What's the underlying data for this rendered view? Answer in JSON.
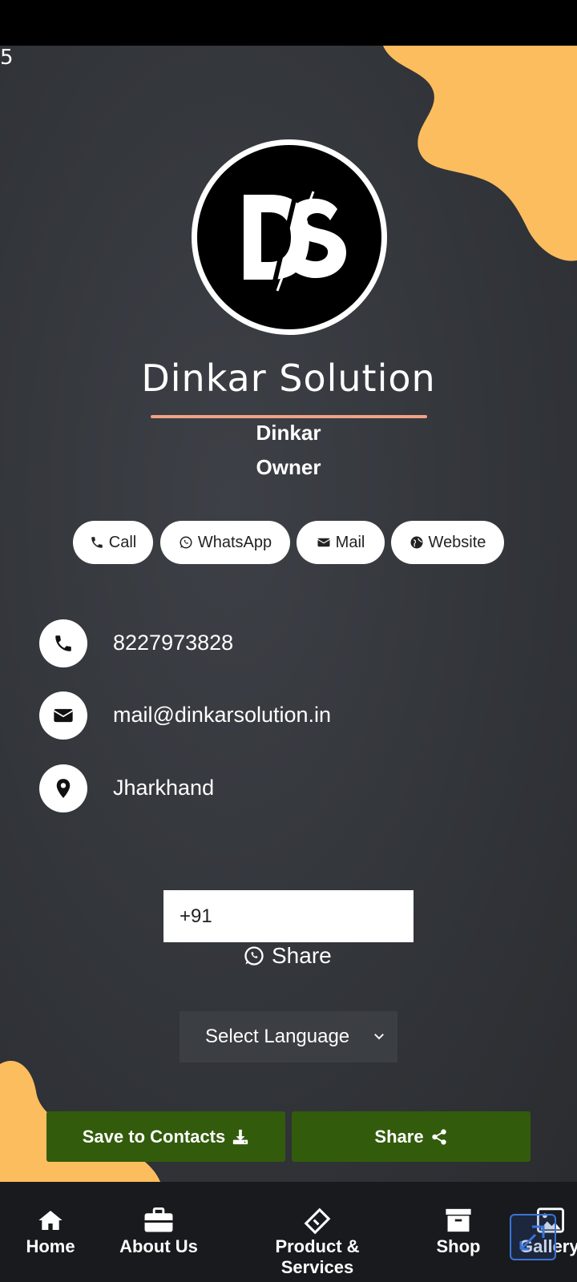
{
  "corner_number": "5",
  "company": {
    "name": "Dinkar Solution",
    "logo_text": "DS"
  },
  "person": {
    "name": "Dinkar",
    "role": "Owner"
  },
  "actions": [
    {
      "label": "Call",
      "icon": "phone-icon"
    },
    {
      "label": "WhatsApp",
      "icon": "whatsapp-icon"
    },
    {
      "label": "Mail",
      "icon": "envelope-icon"
    },
    {
      "label": "Website",
      "icon": "globe-icon"
    }
  ],
  "contact": {
    "phone": "8227973828",
    "email": "mail@dinkarsolution.in",
    "location": "Jharkhand"
  },
  "whatsapp_share": {
    "input_value": "+91",
    "label": "Share"
  },
  "language": {
    "selected": "Select Language"
  },
  "buttons": {
    "save_contacts": "Save to Contacts",
    "share": "Share"
  },
  "nav": [
    {
      "label": "Home",
      "icon": "home-icon"
    },
    {
      "label": "About Us",
      "icon": "briefcase-icon"
    },
    {
      "label": "Product & Services",
      "icon": "ticket-icon"
    },
    {
      "label": "Shop",
      "icon": "archive-box-icon"
    },
    {
      "label": "Gallery",
      "icon": "image-icon"
    }
  ],
  "colors": {
    "accent_blob": "#fcbd5e",
    "button_green": "#325c0c",
    "underline": "#f0a285",
    "nav_bg": "#191a1e"
  }
}
